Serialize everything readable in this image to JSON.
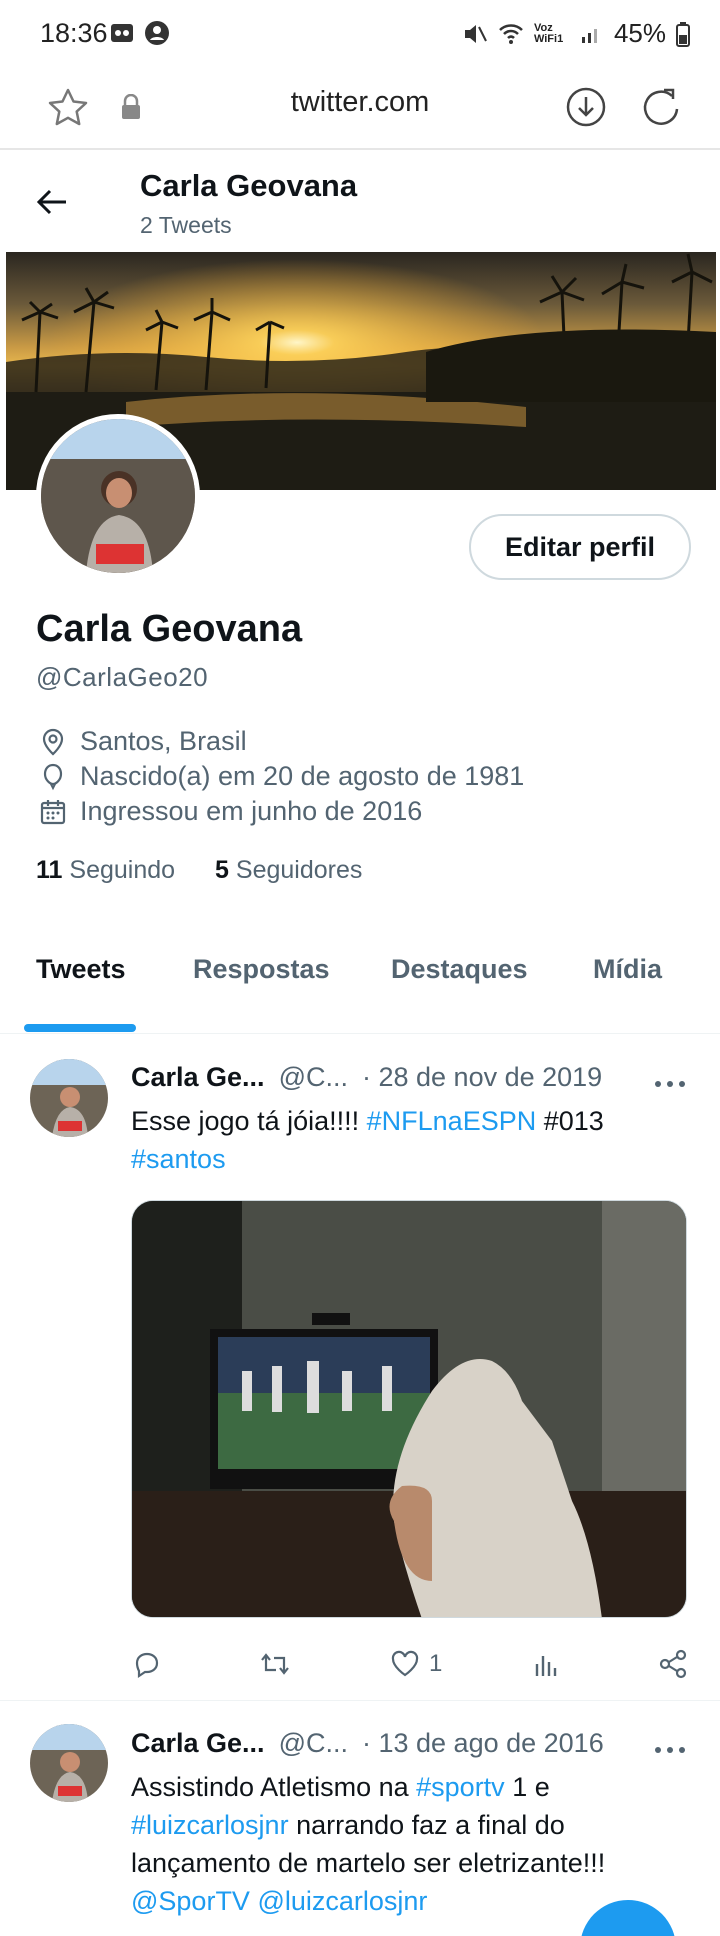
{
  "status": {
    "time": "18:36",
    "battery": "45%",
    "network_label": "Voz WiFi1"
  },
  "browser": {
    "url": "twitter.com"
  },
  "header": {
    "name": "Carla Geovana",
    "tweet_count": "2 Tweets"
  },
  "profile": {
    "edit_button": "Editar perfil",
    "name": "Carla Geovana",
    "handle": "@CarlaGeo20",
    "location": "Santos, Brasil",
    "birth": "Nascido(a) em 20 de agosto de 1981",
    "joined": "Ingressou em junho de 2016",
    "following_count": "11",
    "following_label": "Seguindo",
    "followers_count": "5",
    "followers_label": "Seguidores"
  },
  "tabs": [
    {
      "label": "Tweets"
    },
    {
      "label": "Respostas"
    },
    {
      "label": "Destaques"
    },
    {
      "label": "Mídia"
    }
  ],
  "tweets": [
    {
      "name": "Carla Ge...",
      "handle": "@C...",
      "date": "· 28 de nov de 2019",
      "text_plain_1": "Esse jogo tá jóia!!!! ",
      "text_link_1": "#NFLnaESPN",
      "text_plain_2": " #013",
      "text_link_2": "#santos",
      "likes": "1"
    },
    {
      "name": "Carla Ge...",
      "handle": "@C...",
      "date": "· 13 de ago de 2016",
      "text_plain_1": "Assistindo Atletismo na ",
      "text_link_1": "#sportv",
      "text_plain_2": " 1 e",
      "text_link_2": "#luizcarlosjnr",
      "text_plain_3": " narrando faz a final do lançamento de martelo ser eletrizante!!!",
      "text_link_3": "@SporTV",
      "text_link_4": "@luizcarlosjnr"
    }
  ],
  "colors": {
    "accent": "#1d9bf0",
    "muted": "#536471",
    "text": "#0f1419"
  }
}
